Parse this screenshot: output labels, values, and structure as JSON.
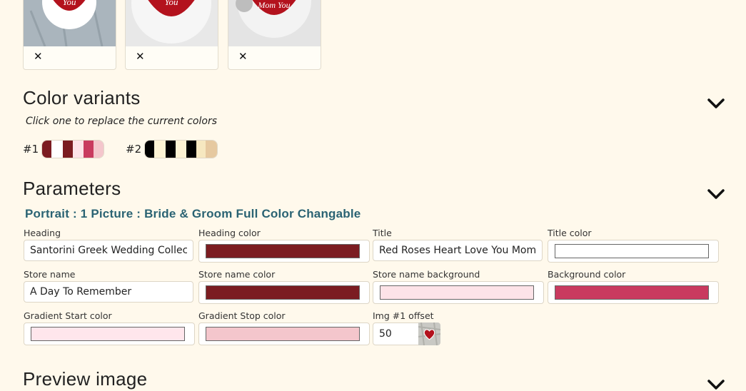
{
  "thumbnails": [
    {
      "remove_glyph": "✕",
      "caption": "You"
    },
    {
      "remove_glyph": "✕",
      "caption": "You"
    },
    {
      "remove_glyph": "✕",
      "caption": "Mom You"
    }
  ],
  "color_variants": {
    "title": "Color variants",
    "hint": "Click one to replace the current colors",
    "variants": [
      {
        "label": "#1",
        "colors": [
          "#7b1c21",
          "#ffffff",
          "#7b1c21",
          "#fde3e8",
          "#c93a5f",
          "#f4c6cc"
        ]
      },
      {
        "label": "#2",
        "colors": [
          "#000000",
          "#fdf3d4",
          "#000000",
          "#fdf3d4",
          "#000000",
          "#f6e8c0",
          "#e6c9a0"
        ]
      }
    ]
  },
  "parameters": {
    "title": "Parameters",
    "subtitle": "Portrait : 1 Picture : Bride & Groom Full Color Changable",
    "fields": {
      "heading": {
        "label": "Heading",
        "value": "Santorini Greek Wedding Collection"
      },
      "heading_color": {
        "label": "Heading color",
        "value": "#7b1c21"
      },
      "title": {
        "label": "Title",
        "value": "Red Roses Heart Love You Mom Mug"
      },
      "title_color": {
        "label": "Title color",
        "value": "#ffffff"
      },
      "store_name": {
        "label": "Store name",
        "value": "A Day To Remember"
      },
      "store_name_color": {
        "label": "Store name color",
        "value": "#7b1c21"
      },
      "store_name_background": {
        "label": "Store name background",
        "value": "#fde3e8"
      },
      "background_color": {
        "label": "Background color",
        "value": "#c93a5f"
      },
      "gradient_start": {
        "label": "Gradient Start color",
        "value": "#ffe6ec"
      },
      "gradient_stop": {
        "label": "Gradient Stop color",
        "value": "#f4c6cc"
      },
      "img_offset": {
        "label": "Img #1 offset",
        "value": "50"
      }
    }
  },
  "preview": {
    "title": "Preview image"
  }
}
